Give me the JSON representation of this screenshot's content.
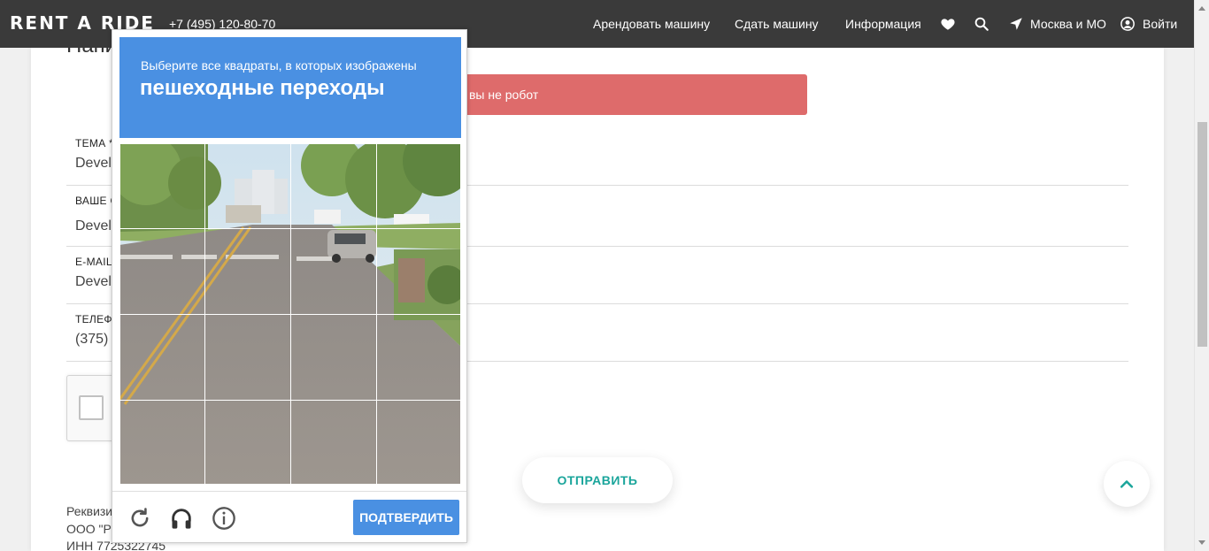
{
  "header": {
    "logo": "RENT A RIDE",
    "phone": "+7 (495) 120-80-70",
    "nav": {
      "rent_car": "Арендовать машину",
      "list_car": "Сдать машину",
      "info": "Информация",
      "city": "Москва и МО",
      "login": "Войти"
    },
    "icons": [
      "heart-icon",
      "search-icon",
      "location-arrow-icon",
      "user-circle-icon"
    ]
  },
  "form": {
    "title": "Напи",
    "error": "ите что вы не робот",
    "fields": [
      {
        "label": "ТЕМА *",
        "value": "Devel"
      },
      {
        "label": "ВАШЕ С",
        "value": "Devel"
      },
      {
        "label": "E-MAIL",
        "value": "Devel"
      },
      {
        "label": "ТЕЛЕФО",
        "value": "(375)"
      }
    ],
    "submit": "ОТПРАВИТЬ"
  },
  "footer": {
    "line1": "Реквизи",
    "line2": "ООО \"Р",
    "line3": "ИНН 7725322745"
  },
  "captcha": {
    "instruction": "Выберите все квадраты, в которых изображены",
    "keyword": "пешеходные переходы",
    "verify": "ПОДТВЕРДИТЬ",
    "grid_rows": 4,
    "grid_cols": 4,
    "icons": [
      "reload-icon",
      "headphones-icon",
      "info-icon"
    ]
  },
  "colors": {
    "header_bg": "#3a3a3a",
    "error_bg": "#de6b6b",
    "accent": "#1aa59b",
    "captcha_blue": "#4a90e2"
  }
}
